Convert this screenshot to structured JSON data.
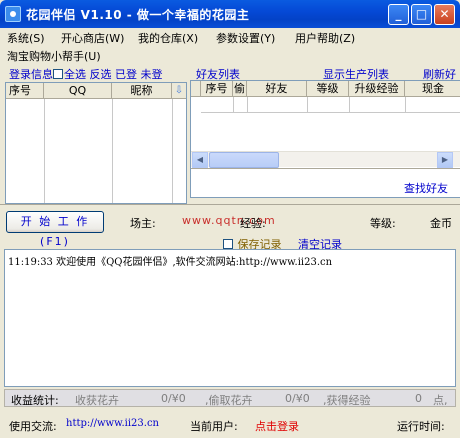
{
  "window": {
    "title": "花园伴侣 V1.10 - 做一个幸福的花园主",
    "minimize": "_",
    "maximize": "□",
    "close": "✕"
  },
  "menu": {
    "items": [
      "系统(S)",
      "开心商店(W)",
      "我的仓库(X)",
      "参数设置(Y)",
      "用户帮助(Z)"
    ],
    "second_row": "淘宝购物小帮手(U)"
  },
  "left_panel": {
    "login_info": "登录信息",
    "select_all": "全选",
    "invert": "反选",
    "logged_in": "已登",
    "not_logged": "未登",
    "columns": [
      "序号",
      "QQ",
      "昵称"
    ]
  },
  "right_panel": {
    "friend_list": "好友列表",
    "show_list": "显示生产列表",
    "refresh": "刷新好",
    "columns": [
      "序号",
      "偷",
      "好友",
      "等级",
      "升级经验",
      "现金"
    ],
    "find_friend": "查找好友"
  },
  "middle": {
    "start_button": "开 始 工 作(F1)",
    "owner_label": "场主:",
    "watermark": "www.qqtn.com",
    "exp_label": "经验:",
    "level_label": "等级:",
    "cash_label": "金币",
    "save_record": "保存记录",
    "clear_record": "清空记录"
  },
  "log": {
    "lines": [
      "11:19:33 欢迎使用《QQ花园伴侣》,软件交流网站:http://www.ii23.cn"
    ]
  },
  "stats": {
    "label": "收益统计:",
    "harvest_label": "收获花卉",
    "harvest_value": "0/¥0",
    "steal_label": ",偷取花卉",
    "steal_value": "0/¥0",
    "exp_label": ",获得经验",
    "exp_value": "0",
    "points_suffix": "点,"
  },
  "status": {
    "exchange_label": "使用交流:",
    "url": "http://www.ii23.cn",
    "current_user_label": "当前用户:",
    "current_user_value": "点击登录",
    "runtime_label": "运行时间:"
  }
}
